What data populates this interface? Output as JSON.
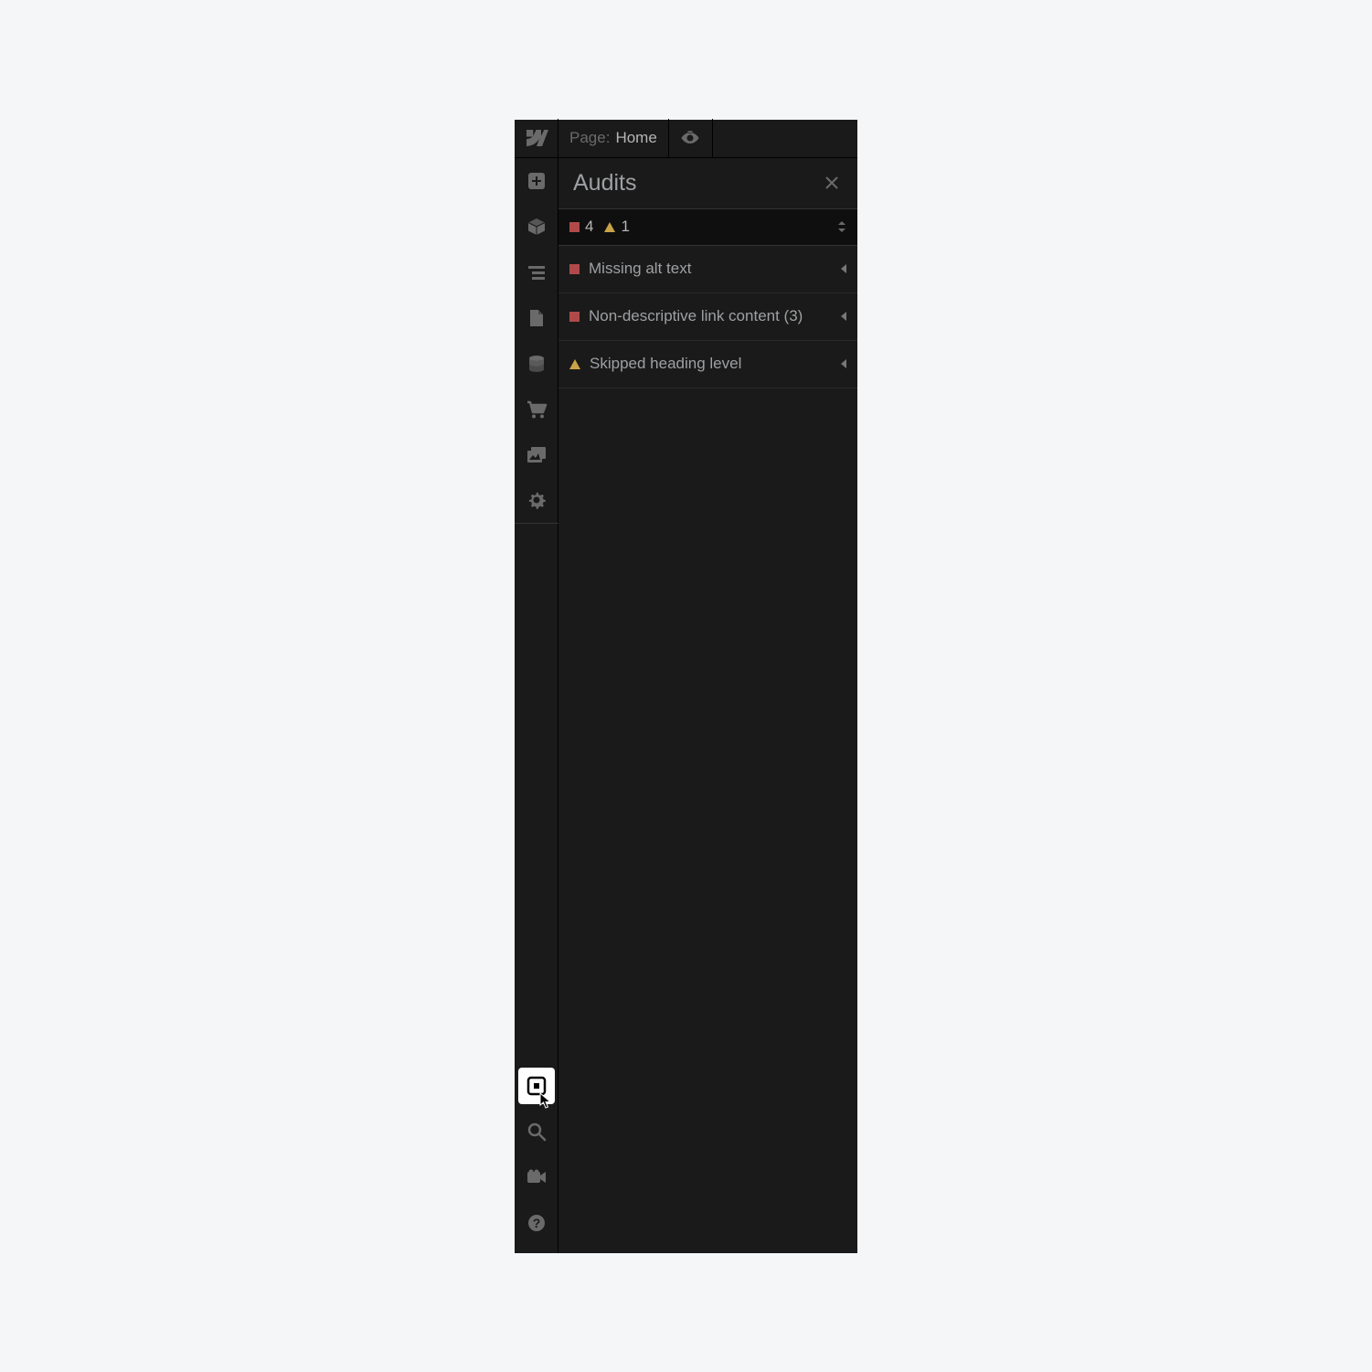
{
  "topbar": {
    "page_label": "Page:",
    "page_name": "Home"
  },
  "panel": {
    "title": "Audits"
  },
  "summary": {
    "error_count": "4",
    "warning_count": "1"
  },
  "audits": {
    "items": [
      {
        "severity": "error",
        "label": "Missing alt text"
      },
      {
        "severity": "error",
        "label": "Non-descriptive link content (3)"
      },
      {
        "severity": "warning",
        "label": "Skipped heading level"
      }
    ]
  },
  "colors": {
    "error": "#b04a4a",
    "warning": "#c9a348",
    "panel_bg": "#1a1a1a",
    "text_muted": "#6a6a6a",
    "text": "#9ea0a3"
  }
}
